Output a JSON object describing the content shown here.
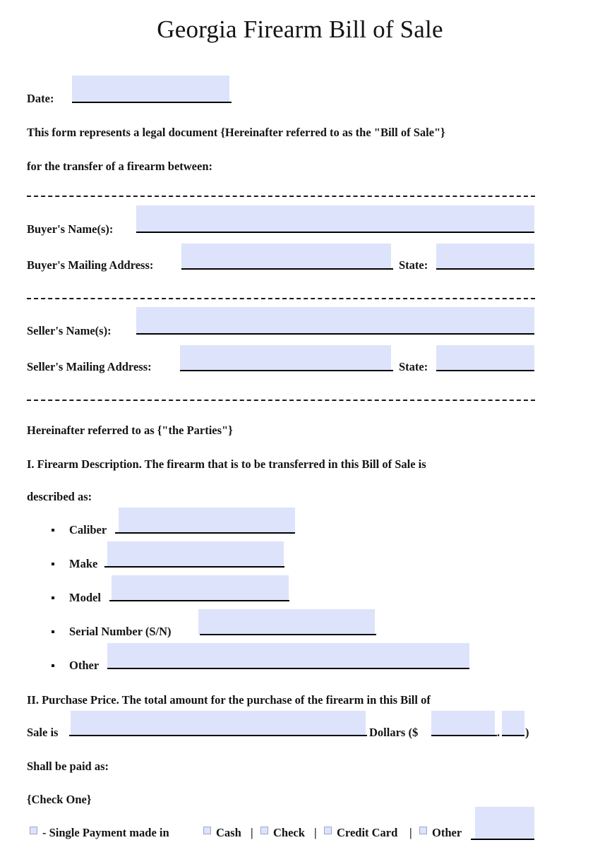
{
  "document": {
    "title": "Georgia Firearm Bill of Sale"
  },
  "date_line": {
    "label": "Date:",
    "value": "",
    "placeholder": ""
  },
  "intro": {
    "line1": "This form represents a legal document {Hereinafter referred to as the \"Bill of Sale\"}",
    "line2": "for the transfer of a firearm between:"
  },
  "buyer": {
    "name_label": "Buyer's Name(s):",
    "name_value": "",
    "address_label": "Buyer's Mailing Address:",
    "address_value": "",
    "state_label": "State:",
    "state_value": ""
  },
  "seller": {
    "name_label": "Seller's Name(s):",
    "name_value": "",
    "address_label": "Seller's Mailing Address:",
    "address_value": "",
    "state_label": "State:",
    "state_value": ""
  },
  "parties_note": "Hereinafter referred to as {\"the Parties\"}",
  "section_one": {
    "heading": "I. Firearm Description.",
    "body_line1": "The firearm that is to be transferred in this Bill of Sale is",
    "body_line2": "described as:",
    "items": [
      {
        "label": "Caliber",
        "value": ""
      },
      {
        "label": "Make",
        "value": ""
      },
      {
        "label": "Model",
        "value": ""
      },
      {
        "label": "Serial Number (S/N)",
        "value": ""
      },
      {
        "label": "Other",
        "value": ""
      }
    ]
  },
  "section_two": {
    "heading": "II. Purchase Price.",
    "body_line1": "The total amount for the purchase of the firearm in this Bill of",
    "sale_is_label": "Sale is",
    "amount_words_value": "",
    "dollars_label": "Dollars ($",
    "amount_dollars_value": "",
    "decimal_separator": ".",
    "amount_cents_value": "",
    "close_paren": ")",
    "shall_be_paid": "Shall be paid as:",
    "check_one": "{Check One}"
  },
  "payment": {
    "single_payment_label": "- Single Payment made in",
    "options": [
      {
        "label": "Cash",
        "checked": false
      },
      {
        "label": "Check",
        "checked": false
      },
      {
        "label": "Credit Card",
        "checked": false
      },
      {
        "label": "Other",
        "checked": false
      }
    ],
    "separator": "|",
    "other_value": ""
  },
  "colors": {
    "field_fill": "#dde3fa",
    "rule": "#000000",
    "text": "#131417",
    "checkbox_border": "#9aa6c8"
  }
}
